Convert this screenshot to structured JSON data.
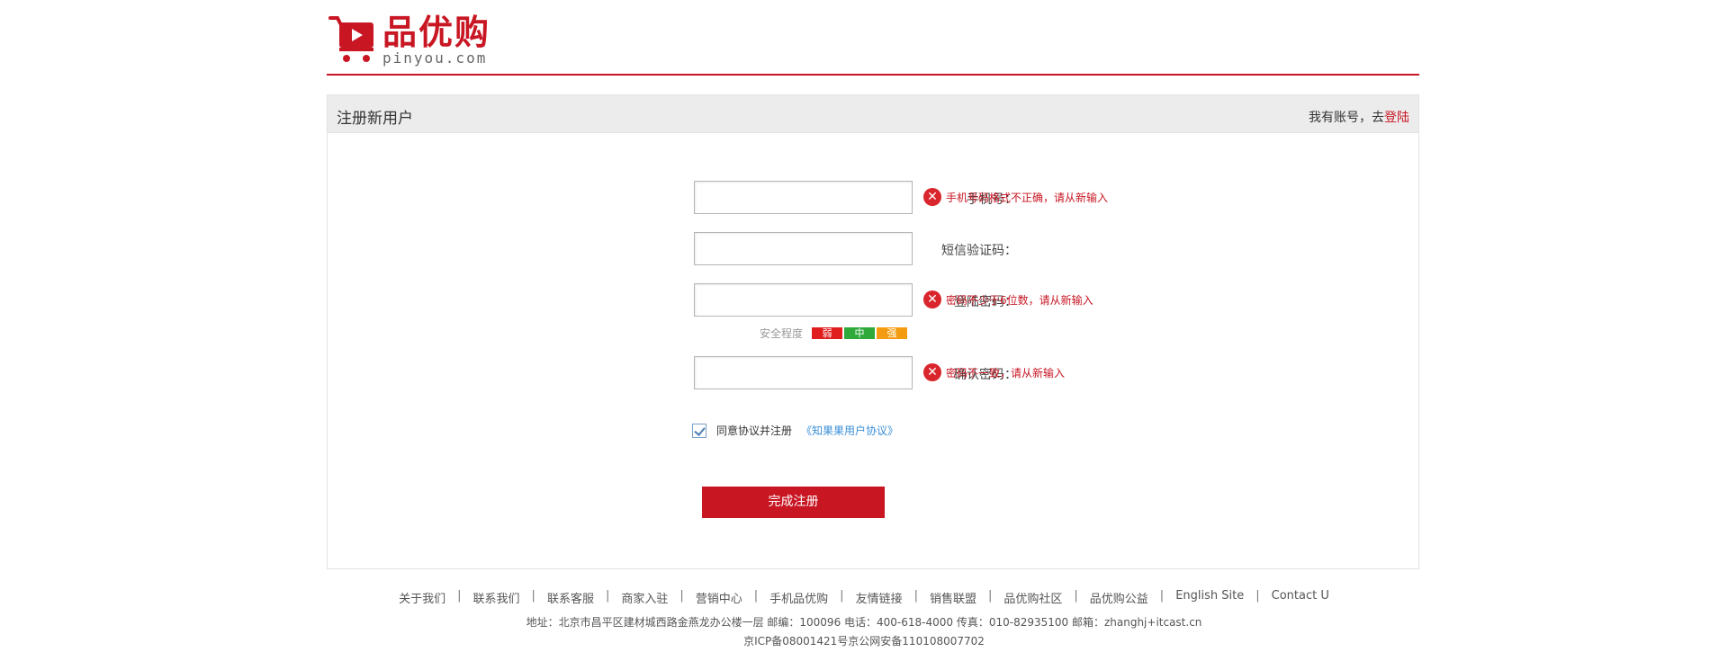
{
  "header": {
    "brand_cn": "品优购",
    "brand_en": "pinyou.com",
    "accent_color": "#c81623"
  },
  "panel": {
    "title": "注册新用户",
    "login_prefix": "我有账号，去",
    "login_link": "登陆"
  },
  "form": {
    "phone": {
      "label": "手机号：",
      "value": "",
      "error": "手机号码格式不正确，请从新输入"
    },
    "sms": {
      "label": "短信验证码：",
      "value": ""
    },
    "password": {
      "label": "登陆密码：",
      "value": "",
      "error": "密码不少于6位数，请从新输入"
    },
    "strength": {
      "label": "安全程度",
      "weak": "弱",
      "mid": "中",
      "strong": "强"
    },
    "confirm": {
      "label": "确认密码：",
      "value": "",
      "error": "密码不一致，请从新输入"
    },
    "agree": {
      "checked": true,
      "text": "同意协议并注册",
      "link": "《知果果用户协议》"
    },
    "submit_label": "完成注册"
  },
  "footer": {
    "links": [
      "关于我们",
      "联系我们",
      "联系客服",
      "商家入驻",
      "营销中心",
      "手机品优购",
      "友情链接",
      "销售联盟",
      "品优购社区",
      "品优购公益",
      "English Site",
      "Contact U"
    ],
    "address": "地址：北京市昌平区建材城西路金燕龙办公楼一层 邮编：100096 电话：400-618-4000 传真：010-82935100 邮箱：zhanghj+itcast.cn",
    "icp": "京ICP备08001421号京公网安备110108007702"
  }
}
